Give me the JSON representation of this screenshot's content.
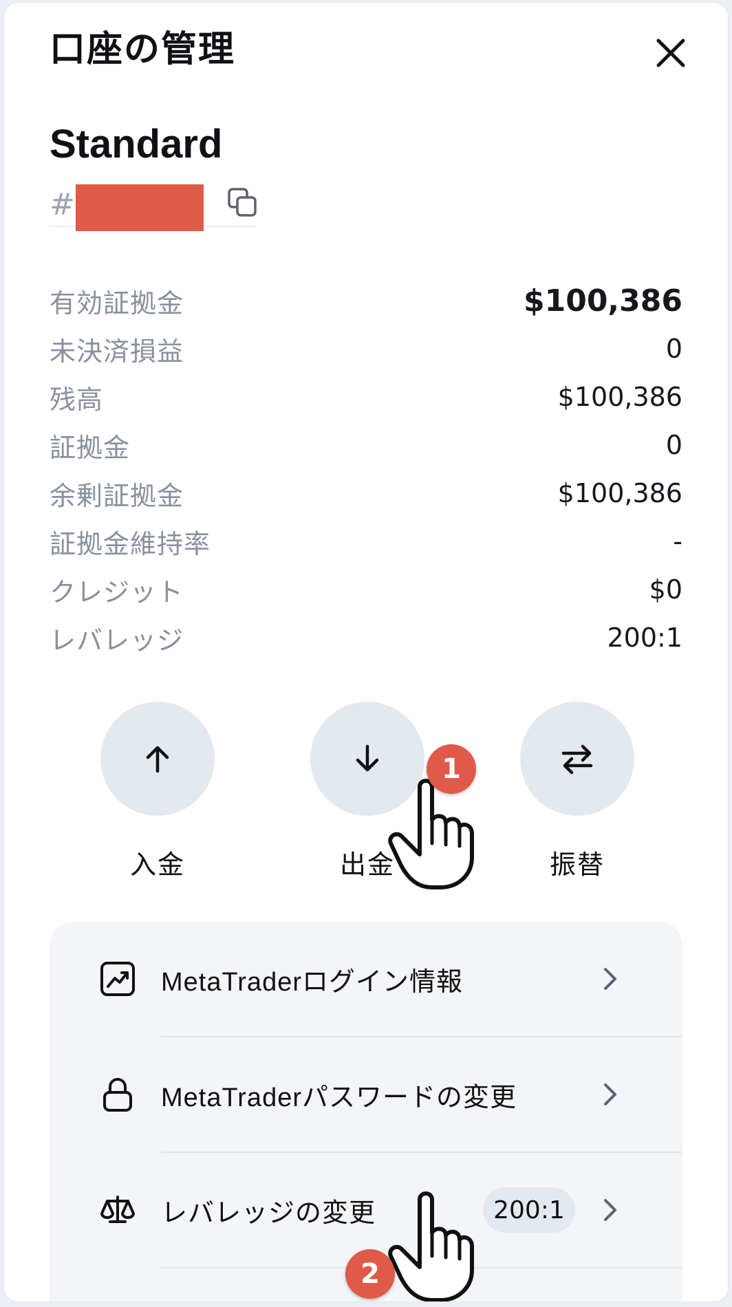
{
  "header": {
    "title": "口座の管理"
  },
  "account": {
    "type": "Standard",
    "hash": "#"
  },
  "stats": [
    {
      "label": "有効証拠金",
      "value": "$100,386"
    },
    {
      "label": "未決済損益",
      "value": "0"
    },
    {
      "label": "残高",
      "value": "$100,386"
    },
    {
      "label": "証拠金",
      "value": "0"
    },
    {
      "label": "余剰証拠金",
      "value": "$100,386"
    },
    {
      "label": "証拠金維持率",
      "value": "-"
    },
    {
      "label": "クレジット",
      "value": "$0"
    },
    {
      "label": "レバレッジ",
      "value": "200:1"
    }
  ],
  "actions": [
    {
      "label": "入金",
      "icon": "arrow-up-icon"
    },
    {
      "label": "出金",
      "icon": "arrow-down-icon"
    },
    {
      "label": "振替",
      "icon": "transfer-icon"
    }
  ],
  "menu": [
    {
      "label": "MetaTraderログイン情報",
      "icon": "chart-icon"
    },
    {
      "label": "MetaTraderパスワードの変更",
      "icon": "lock-icon"
    },
    {
      "label": "レバレッジの変更",
      "icon": "scale-icon",
      "badge": "200:1"
    }
  ],
  "annotations": {
    "step1": "1",
    "step2": "2"
  },
  "colors": {
    "accent_red": "#df5a48",
    "circle_bg": "#e4e9f0",
    "card_bg": "#f3f5f8",
    "label_gray": "#8890a0"
  }
}
